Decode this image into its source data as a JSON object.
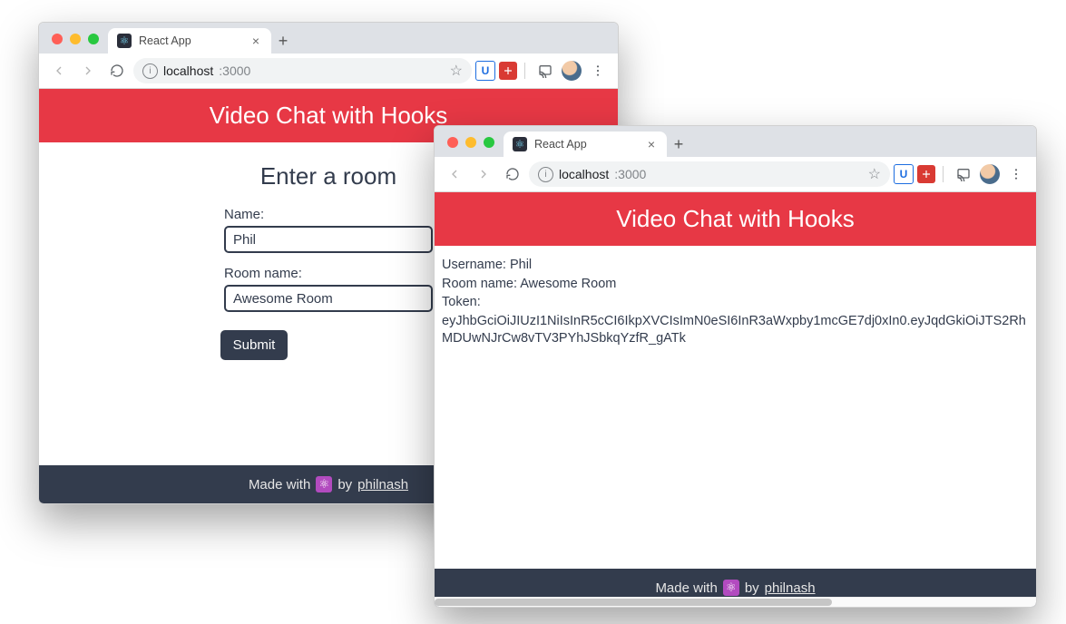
{
  "browser": {
    "tab_title": "React App",
    "url_host": "localhost",
    "url_port": ":3000",
    "info_symbol": "i",
    "ext_u": "U",
    "favicon": "⚛"
  },
  "app": {
    "header": "Video Chat with Hooks",
    "footer_prefix": "Made with",
    "footer_mid": "by",
    "footer_link": "philnash",
    "react_logo": "⚛"
  },
  "form": {
    "heading": "Enter a room",
    "name_label": "Name:",
    "name_value": "Phil",
    "room_label": "Room name:",
    "room_value": "Awesome Room",
    "submit": "Submit"
  },
  "result": {
    "username_label": "Username:",
    "username_value": "Phil",
    "room_label": "Room name:",
    "room_value": "Awesome Room",
    "token_label": "Token:",
    "token_value": "eyJhbGciOiJIUzI1NiIsInR5cCI6IkpXVCIsImN0eSI6InR3aWxpby1mcGE7dj0xIn0.eyJqdGkiOiJTS2RhMDUwNJrCw8vTV3PYhJSbkqYzfR_gATk"
  }
}
